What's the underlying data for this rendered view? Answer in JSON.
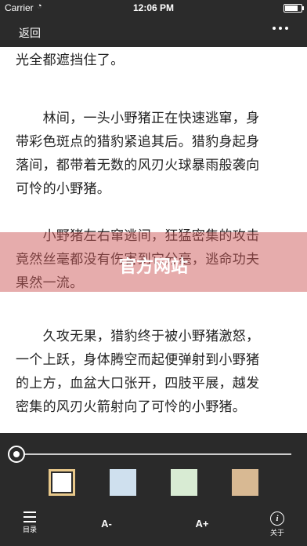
{
  "status_bar": {
    "carrier": "Carrier",
    "time": "12:06 PM",
    "wifi_icon": "wifi-icon",
    "battery_level": 0.9
  },
  "nav": {
    "back_label": "返回",
    "more_icon": "more-horizontal-icon"
  },
  "content": {
    "paragraphs": [
      "　　多人合树高耸入云，枝繁叶茂，将阳\n光全都遮挡住了。",
      "　　林间，一头小野猪正在快速逃窜，身\n带彩色斑点的猎豹紧追其后。猎豹身起身\n落间，都带着无数的风刃火球暴雨般袭向\n可怜的小野猪。",
      "　　小野猪左右窜逃间，狂猛密集的攻击\n竟然丝毫都没有伤害到它分毫，逃命功夫\n果然一流。",
      "　　久攻无果，猎豹终于被小野猪激怒，\n一个上跃，身体腾空而起便弹射到小野猪\n的上方，血盆大口张开，四肢平展，越发\n密集的风刃火箭射向了可怜的小野猪。"
    ]
  },
  "watermark": {
    "text": "官方网站",
    "color": "#cd5a5a"
  },
  "reader_panel": {
    "progress": 0.0,
    "themes": [
      {
        "name": "white",
        "color": "#ffffff",
        "selected": true
      },
      {
        "name": "blue",
        "color": "#cfe0ee",
        "selected": false
      },
      {
        "name": "green",
        "color": "#d8ebd3",
        "selected": false
      },
      {
        "name": "tan",
        "color": "#d8b993",
        "selected": false
      }
    ],
    "toolbar": {
      "toc_label": "目录",
      "toc_icon": "list-icon",
      "font_smaller_label": "A-",
      "font_larger_label": "A+",
      "about_label": "关于",
      "about_icon": "info-icon"
    }
  }
}
